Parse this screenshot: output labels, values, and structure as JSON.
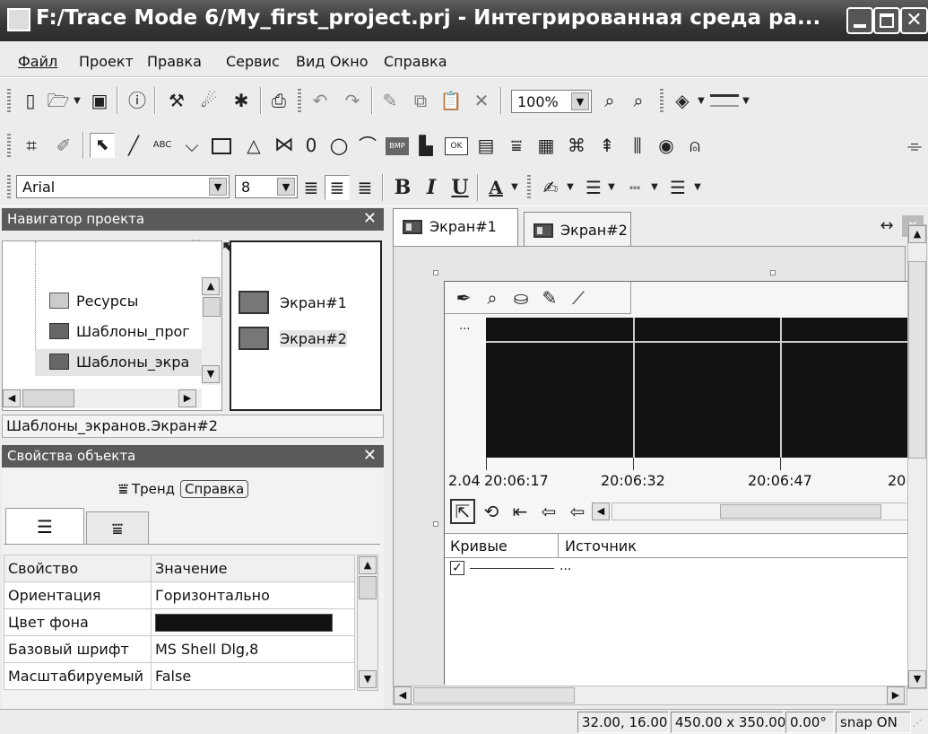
{
  "window": {
    "title": "F:/Trace Mode 6/My_first_project.prj - Интегрированная среда ра..."
  },
  "menu": [
    "Файл",
    "Проект",
    "Правка",
    "Сервис",
    "Вид",
    "Окно",
    "Справка"
  ],
  "toolbar": {
    "zoom": "100%",
    "font_name": "Arial",
    "font_size": "8",
    "glyph_zero": "0",
    "abc": "ABC",
    "bmp": "BMP",
    "ok": "OK",
    "bold": "B",
    "italic": "I",
    "underline": "U",
    "font_color": "A"
  },
  "navigator": {
    "title": "Навигатор проекта",
    "tree": [
      "Ресурсы",
      "Шаблоны_прог",
      "Шаблоны_экра"
    ],
    "screens": [
      "Экран#1",
      "Экран#2"
    ],
    "path": "Шаблоны_экранов.Экран#2"
  },
  "props": {
    "title": "Свойства объекта",
    "object_name": "Тренд",
    "help": "Справка",
    "headers": [
      "Свойство",
      "Значение"
    ],
    "rows": [
      [
        "Ориентация",
        "Горизонтально"
      ],
      [
        "Цвет фона",
        ""
      ],
      [
        "Базовый шрифт",
        "MS Shell Dlg,8"
      ],
      [
        "Масштабируемый",
        "False"
      ]
    ],
    "bg_color": "#111111"
  },
  "tabs": [
    "Экран#1",
    "Экран#2"
  ],
  "trend": {
    "ellipsis": "...",
    "time_labels": [
      "2.04",
      "20:06:17",
      "20:06:32",
      "20:06:47",
      "20"
    ],
    "headers": [
      "Кривые",
      "Источник"
    ],
    "row_source": "..."
  },
  "statusbar": {
    "coords": "32.00, 16.00",
    "size": "450.00 x 350.00",
    "angle": "0.00°",
    "snap": "snap ON"
  }
}
